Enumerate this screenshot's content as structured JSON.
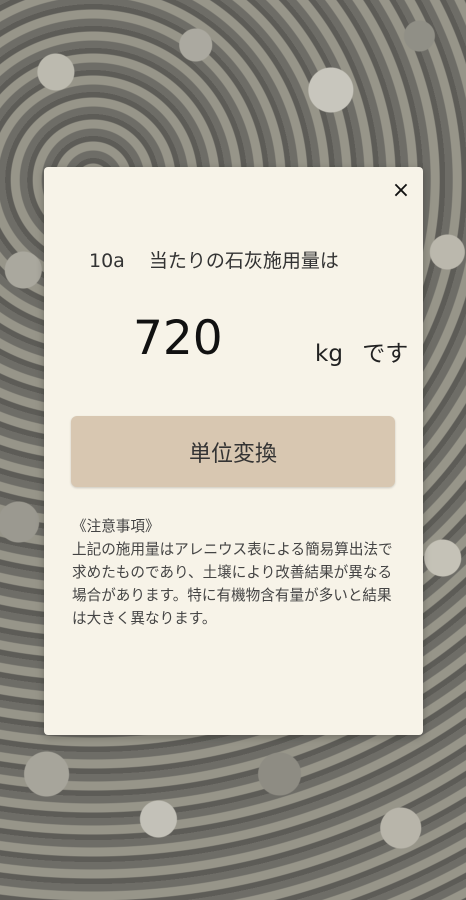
{
  "dialog": {
    "close_icon": "close-icon",
    "close_symbol": "×",
    "title_prefix": "10a",
    "title_text": "当たりの石灰施用量は",
    "result_value": "720",
    "unit_kg": "kg",
    "unit_suffix": "です",
    "convert_button_label": "単位変換",
    "note_heading": "《注意事項》",
    "note_body": "上記の施用量はアレニウス表による簡易算出法で求めたものであり、土壌により改善結果が異なる場合があります。特に有機物含有量が多いと結果は大きく異なります。"
  }
}
